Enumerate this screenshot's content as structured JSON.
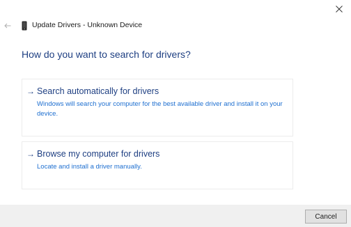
{
  "window": {
    "title": "Update Drivers - Unknown Device"
  },
  "icons": {
    "close": "close-icon",
    "back": "back-arrow-icon",
    "device": "device-icon"
  },
  "heading": "How do you want to search for drivers?",
  "options": [
    {
      "arrow": "→",
      "title": "Search automatically for drivers",
      "description": "Windows will search your computer for the best available driver and install it on your device."
    },
    {
      "arrow": "→",
      "title": "Browse my computer for drivers",
      "description": "Locate and install a driver manually."
    }
  ],
  "footer": {
    "cancel_label": "Cancel"
  },
  "colors": {
    "link_title": "#1e3f82",
    "link_desc": "#1e6fd0",
    "footer_bg": "#f0f0f0"
  }
}
